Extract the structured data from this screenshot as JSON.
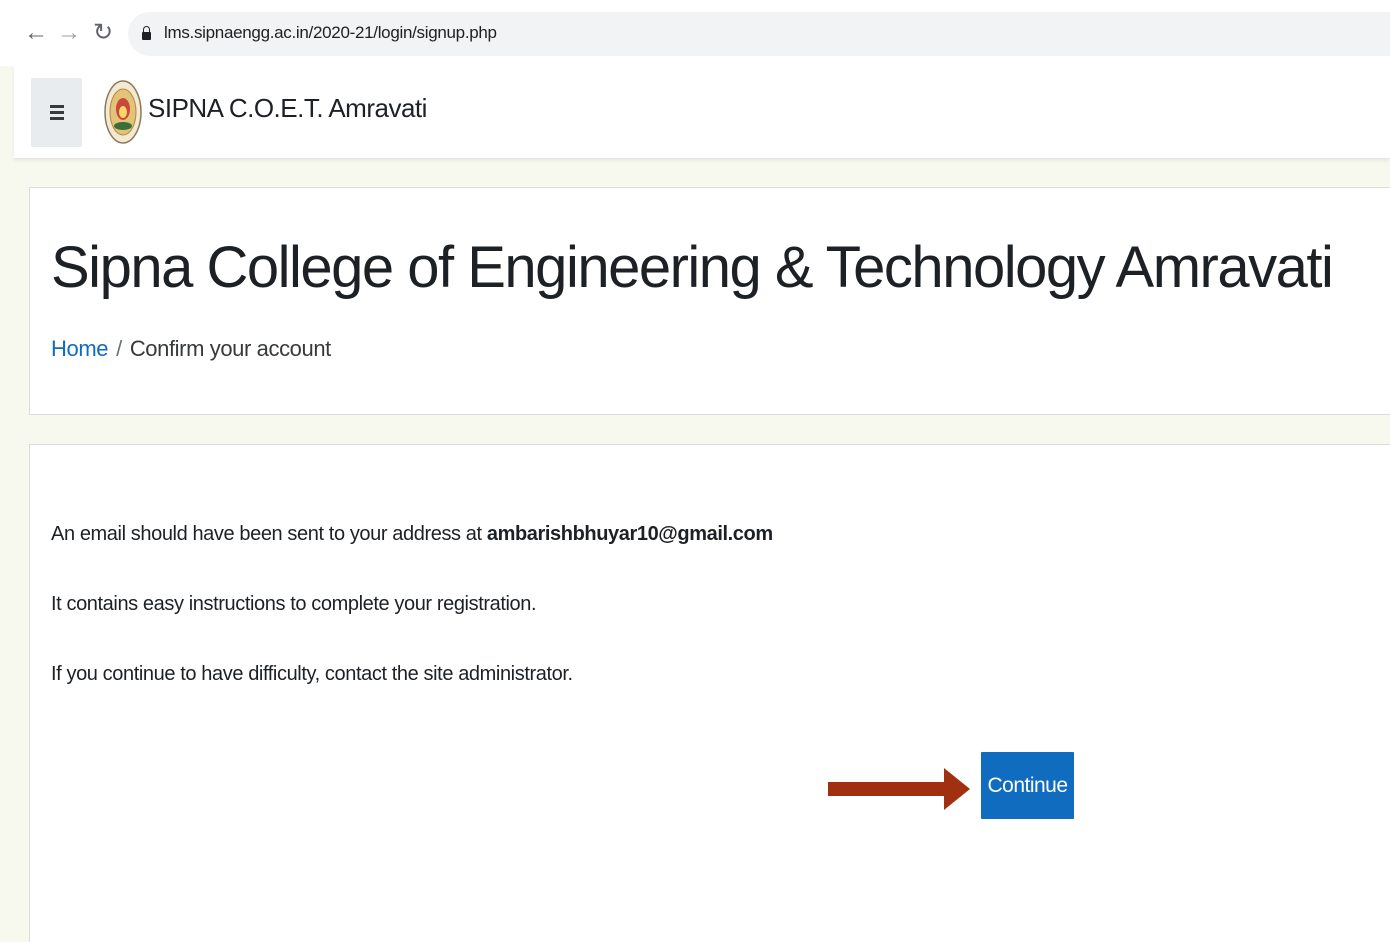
{
  "browser": {
    "url": "lms.sipnaengg.ac.in/2020-21/login/signup.php",
    "back_icon": "arrow-left-icon",
    "forward_icon": "arrow-right-icon",
    "reload_icon": "reload-icon"
  },
  "navbar": {
    "site_name": "SIPNA C.O.E.T. Amravati",
    "menu_icon": "hamburger-icon"
  },
  "header": {
    "title": "Sipna College of Engineering & Technology Amravati",
    "breadcrumb": {
      "home": "Home",
      "separator": "/",
      "current": "Confirm your account"
    }
  },
  "main": {
    "email_message_prefix": "An email should have been sent to your address at ",
    "email": "ambarishbhuyar10@gmail.com",
    "instructions": "It contains easy instructions to complete your registration.",
    "difficulty": "If you continue to have difficulty, contact the site administrator.",
    "continue_label": "Continue"
  },
  "colors": {
    "primary": "#0f6cbf",
    "arrow": "#a0300f",
    "page_bg": "#f7f9ef"
  }
}
